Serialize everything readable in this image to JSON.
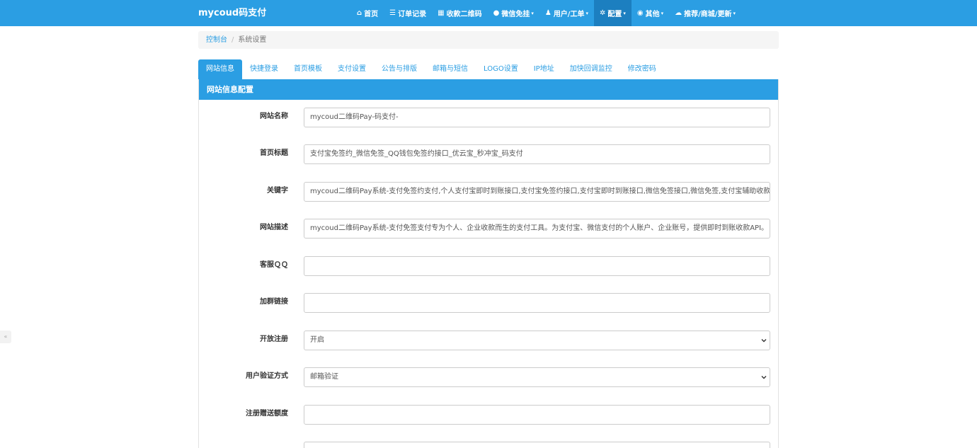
{
  "navbar": {
    "brand": "mycoud码支付",
    "items": [
      {
        "icon": "home-icon",
        "glyph": "⌂",
        "label": "首页",
        "caret": false
      },
      {
        "icon": "list-icon",
        "glyph": "☰",
        "label": "订单记录",
        "caret": false
      },
      {
        "icon": "qrcode-icon",
        "glyph": "▦",
        "label": "收款二维码",
        "caret": false
      },
      {
        "icon": "wechat-icon",
        "glyph": "●",
        "label": "微信免挂",
        "caret": true
      },
      {
        "icon": "user-icon",
        "glyph": "♟",
        "label": "用户/工单",
        "caret": true
      },
      {
        "icon": "gear-icon",
        "glyph": "✲",
        "label": "配置",
        "caret": true,
        "active": true
      },
      {
        "icon": "globe-icon",
        "glyph": "◉",
        "label": "其他",
        "caret": true
      },
      {
        "icon": "cloud-icon",
        "glyph": "☁",
        "label": "推荐/商城/更新",
        "caret": true
      }
    ],
    "caret_glyph": "▾"
  },
  "breadcrumb": {
    "home": "控制台",
    "separator": "/",
    "current": "系统设置"
  },
  "tabs": [
    {
      "label": "网站信息",
      "active": true
    },
    {
      "label": "快捷登录"
    },
    {
      "label": "首页模板"
    },
    {
      "label": "支付设置"
    },
    {
      "label": "公告与排版"
    },
    {
      "label": "邮箱与短信"
    },
    {
      "label": "LOGO设置"
    },
    {
      "label": "IP地址"
    },
    {
      "label": "加快回调监控"
    },
    {
      "label": "修改密码"
    }
  ],
  "panel": {
    "title": "网站信息配置",
    "fields": [
      {
        "label": "网站名称",
        "type": "input",
        "value": "mycoud二维码Pay-码支付-"
      },
      {
        "label": "首页标题",
        "type": "input",
        "value": "支付宝免签约_微信免签_QQ钱包免签约接口_优云宝_秒冲宝_码支付"
      },
      {
        "label": "关键字",
        "type": "input",
        "value": "mycoud二维码Pay系统-支付免签约支付,个人支付宝即时到账接口,支付宝免签约接口,支付宝即时到账接口,微信免签接口,微信免签,支付宝辅助收款"
      },
      {
        "label": "网站描述",
        "type": "input",
        "value": "mycoud二维码Pay系统-支付免签支付专为个人、企业收款而生的支付工具。为支付宝、微信支付的个人账户、企业账号，提供即时到账收款API。"
      },
      {
        "label": "客服ＱＱ",
        "type": "input",
        "value": ""
      },
      {
        "label": "加群链接",
        "type": "input",
        "value": ""
      },
      {
        "label": "开放注册",
        "type": "select",
        "value": "开启"
      },
      {
        "label": "用户验证方式",
        "type": "select",
        "value": "邮箱验证"
      },
      {
        "label": "注册赠送额度",
        "type": "input",
        "value": ""
      },
      {
        "label": "",
        "type": "input",
        "value": ""
      }
    ]
  },
  "side_tab": {
    "glyph": "«"
  },
  "colors": {
    "primary": "#2b9ee3",
    "primary_dark": "#1c7fc0"
  }
}
